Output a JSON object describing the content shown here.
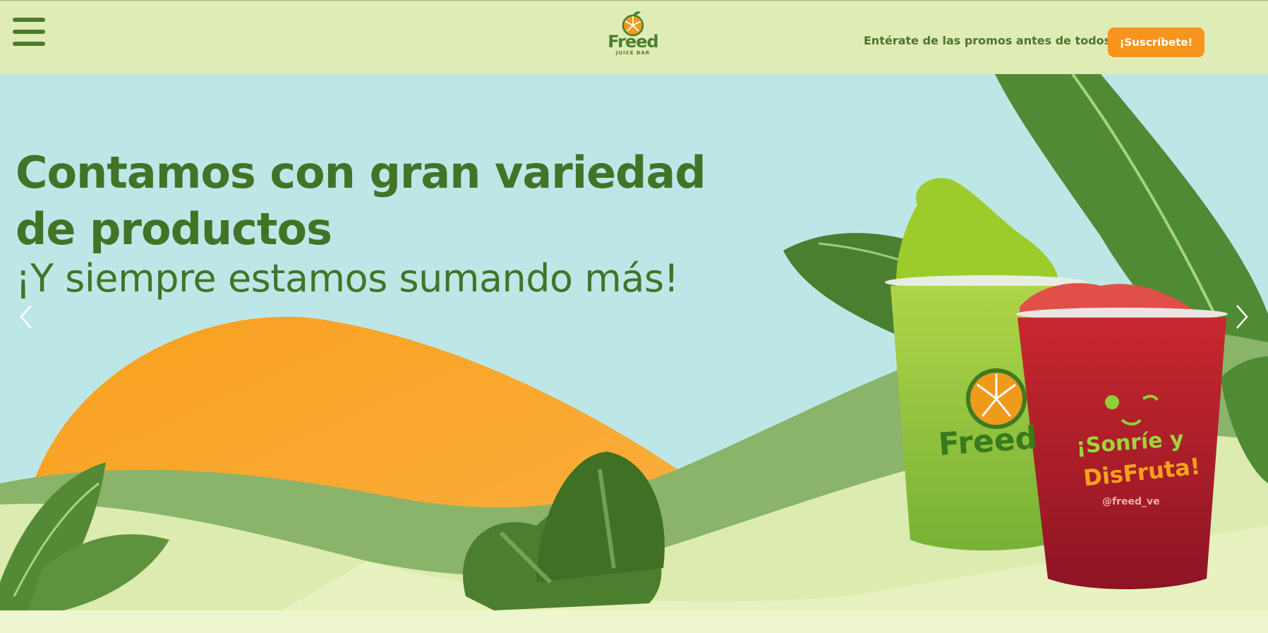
{
  "header": {
    "menu_icon": "hamburger-menu-icon",
    "logo": {
      "name": "Freed",
      "sub": "JUICE BAR"
    },
    "promo_text": "Entérate de las promos antes de todos",
    "subscribe_label": "¡Suscríbete!"
  },
  "hero": {
    "headline": "Contamos con gran variedad de productos",
    "subheadline": "¡Y siempre estamos sumando más!",
    "prev_icon": "chevron-left-icon",
    "next_icon": "chevron-right-icon",
    "green_cup_logo": "Freed",
    "red_cup_text_1": "¡Sonríe y",
    "red_cup_text_2": "DisFruta!",
    "red_cup_handle": "@freed_ve"
  },
  "colors": {
    "header_bg": "#e0ecb5",
    "brand_green": "#437327",
    "accent_orange": "#f7941d",
    "sky": "#bde7e7"
  }
}
